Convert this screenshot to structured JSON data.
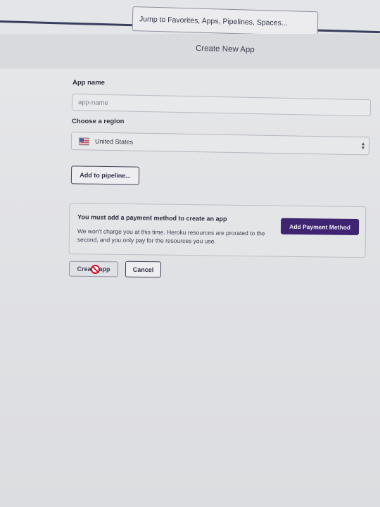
{
  "header": {
    "search_placeholder": "Jump to Favorites, Apps, Pipelines, Spaces..."
  },
  "page": {
    "title": "Create New App"
  },
  "form": {
    "app_name_label": "App name",
    "app_name_placeholder": "app-name",
    "app_name_value": "",
    "region_label": "Choose a region",
    "region_value": "United States",
    "region_flag_icon": "us-flag-icon",
    "region_chevron_icon": "chevron-updown-icon",
    "add_pipeline_label": "Add to pipeline..."
  },
  "payment_notice": {
    "title": "You must add a payment method to create an app",
    "body": "We won't charge you at this time. Heroku resources are prorated to the second, and you only pay for the resources you use.",
    "button_label": "Add Payment Method"
  },
  "actions": {
    "create_label_start": "Crea",
    "create_label_end": "app",
    "create_cursor_icon": "not-allowed-cursor-icon",
    "cancel_label": "Cancel"
  },
  "colors": {
    "accent": "#3f2571",
    "not_allowed": "#d4102b"
  }
}
